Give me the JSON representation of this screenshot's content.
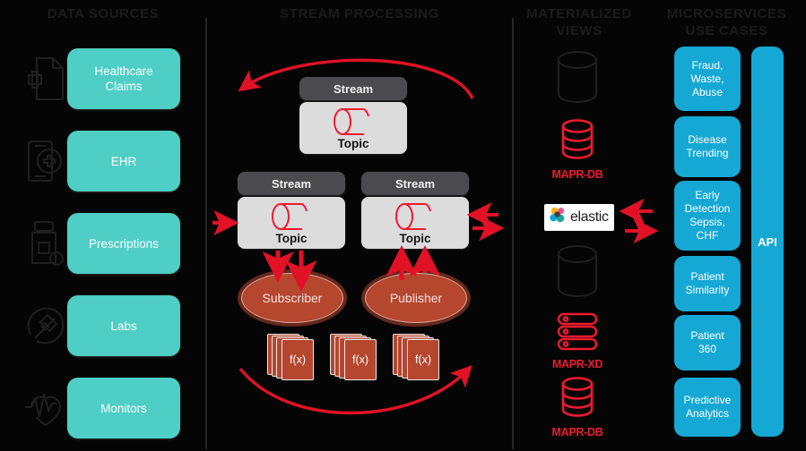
{
  "columns": [
    {
      "id": "data-sources",
      "title": "DATA SOURCES"
    },
    {
      "id": "stream-processing",
      "title": "STREAM PROCESSING"
    },
    {
      "id": "materialized-views",
      "title": "MATERIALIZED\nVIEWS"
    },
    {
      "id": "microservices",
      "title": "MICROSERVICES\nUSE CASES"
    }
  ],
  "data_sources": {
    "items": [
      {
        "label": "Healthcare\nClaims",
        "icon": "document-medical-icon"
      },
      {
        "label": "EHR",
        "icon": "mobile-health-record-icon"
      },
      {
        "label": "Prescriptions",
        "icon": "pill-bottle-icon"
      },
      {
        "label": "Labs",
        "icon": "syringe-icon"
      },
      {
        "label": "Monitors",
        "icon": "heartbeat-icon"
      }
    ]
  },
  "stream_processing": {
    "streams": [
      {
        "id": "stream-top",
        "header": "Stream",
        "topic": "Topic"
      },
      {
        "id": "stream-left",
        "header": "Stream",
        "topic": "Topic"
      },
      {
        "id": "stream-right",
        "header": "Stream",
        "topic": "Topic"
      }
    ],
    "nodes": [
      {
        "id": "subscriber",
        "label": "Subscriber"
      },
      {
        "id": "publisher",
        "label": "Publisher"
      }
    ],
    "functions": [
      {
        "label": "f(x)"
      },
      {
        "label": "f(x)"
      },
      {
        "label": "f(x)"
      }
    ]
  },
  "materialized_views": {
    "items": [
      {
        "id": "db-cylinder-top",
        "label": "",
        "icon": "database-cylinder-icon"
      },
      {
        "id": "mapr-db-top",
        "label": "MAPR-DB",
        "icon": "mapr-db-icon"
      },
      {
        "id": "elastic",
        "label": "elastic",
        "icon": "elastic-logo-icon"
      },
      {
        "id": "db-cylinder-mid",
        "label": "",
        "icon": "database-cylinder-icon"
      },
      {
        "id": "mapr-xd",
        "label": "MAPR-XD",
        "icon": "mapr-xd-icon"
      },
      {
        "id": "mapr-db-bottom",
        "label": "MAPR-DB",
        "icon": "mapr-db-icon"
      }
    ]
  },
  "microservices": {
    "use_cases": [
      {
        "label": "Fraud,\nWaste,\nAbuse"
      },
      {
        "label": "Disease\nTrending"
      },
      {
        "label": "Early\nDetection\nSepsis,\nCHF"
      },
      {
        "label": "Patient\nSimilarity"
      },
      {
        "label": "Patient\n360"
      },
      {
        "label": "Predictive\nAnalytics"
      }
    ],
    "api": {
      "label": "API"
    }
  },
  "colors": {
    "background": "#050505",
    "teal": "#4ecec5",
    "blue": "#16a8d4",
    "red": "#ed1b2e",
    "brick": "#b5472f",
    "stream_header": "#4b4b4d",
    "stream_body": "#dcdcdc",
    "header_text": "#1b1b1b",
    "divider": "#262626"
  }
}
